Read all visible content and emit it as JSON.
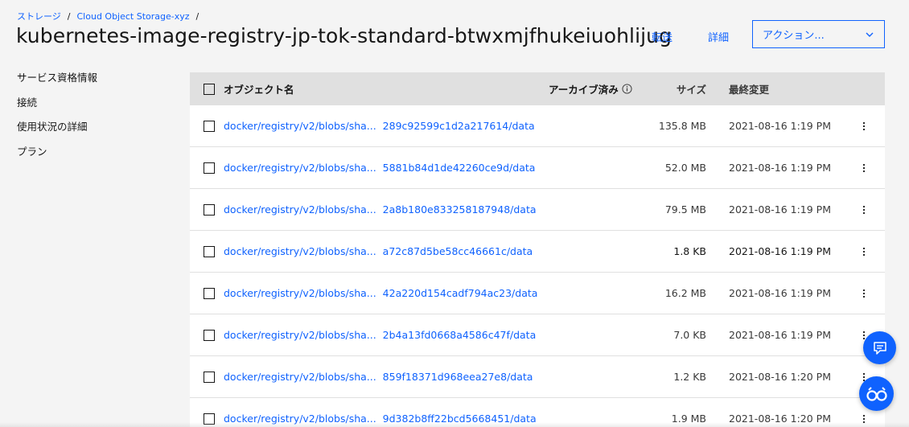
{
  "breadcrumb": {
    "items": [
      "ストレージ",
      "Cloud Object Storage-xyz"
    ],
    "separator": "/"
  },
  "page_title": "kubernetes-image-registry-jp-tok-standard-btwxmjfhukeiuohlijug",
  "header": {
    "transfer_label": "転送",
    "details_label": "詳細",
    "actions_label": "アクション..."
  },
  "side_nav": {
    "items": [
      "サービス資格情報",
      "接続",
      "使用状況の詳細",
      "プラン"
    ]
  },
  "table": {
    "columns": {
      "name": "オブジェクト名",
      "archived": "アーカイブ済み",
      "size": "サイズ",
      "modified": "最終変更"
    },
    "rows": [
      {
        "name_prefix": "docker/registry/v2/blobs/sha...",
        "name_suffix": "289c92599c1d2a217614/data",
        "size": "135.8 MB",
        "modified": "2021-08-16 1:19 PM"
      },
      {
        "name_prefix": "docker/registry/v2/blobs/sha...",
        "name_suffix": "5881b84d1de42260ce9d/data",
        "size": "52.0 MB",
        "modified": "2021-08-16 1:19 PM"
      },
      {
        "name_prefix": "docker/registry/v2/blobs/sha...",
        "name_suffix": "2a8b180e833258187948/data",
        "size": "79.5 MB",
        "modified": "2021-08-16 1:19 PM"
      },
      {
        "name_prefix": "docker/registry/v2/blobs/sha...",
        "name_suffix": "a72c87d5be58cc46661c/data",
        "size": "1.8 KB",
        "modified": "2021-08-16 1:19 PM"
      },
      {
        "name_prefix": "docker/registry/v2/blobs/sha...",
        "name_suffix": "42a220d154cadf794ac23/data",
        "size": "16.2 MB",
        "modified": "2021-08-16 1:19 PM"
      },
      {
        "name_prefix": "docker/registry/v2/blobs/sha...",
        "name_suffix": "2b4a13fd0668a4586c47f/data",
        "size": "7.0 KB",
        "modified": "2021-08-16 1:19 PM"
      },
      {
        "name_prefix": "docker/registry/v2/blobs/sha...",
        "name_suffix": "859f18371d968eea27e8/data",
        "size": "1.2 KB",
        "modified": "2021-08-16 1:20 PM"
      },
      {
        "name_prefix": "docker/registry/v2/blobs/sha...",
        "name_suffix": "9d382b8ff22bcd5668451/data",
        "size": "1.9 MB",
        "modified": "2021-08-16 1:20 PM"
      }
    ]
  },
  "icons": {
    "info": "info-icon",
    "overflow": "overflow-menu-icon",
    "chevron": "chevron-down-icon",
    "chat": "chat-icon",
    "assistant": "assistant-icon"
  },
  "colors": {
    "accent": "#0f62fe",
    "header_bg": "#e0e0e0",
    "page_bg": "#f4f4f4"
  }
}
